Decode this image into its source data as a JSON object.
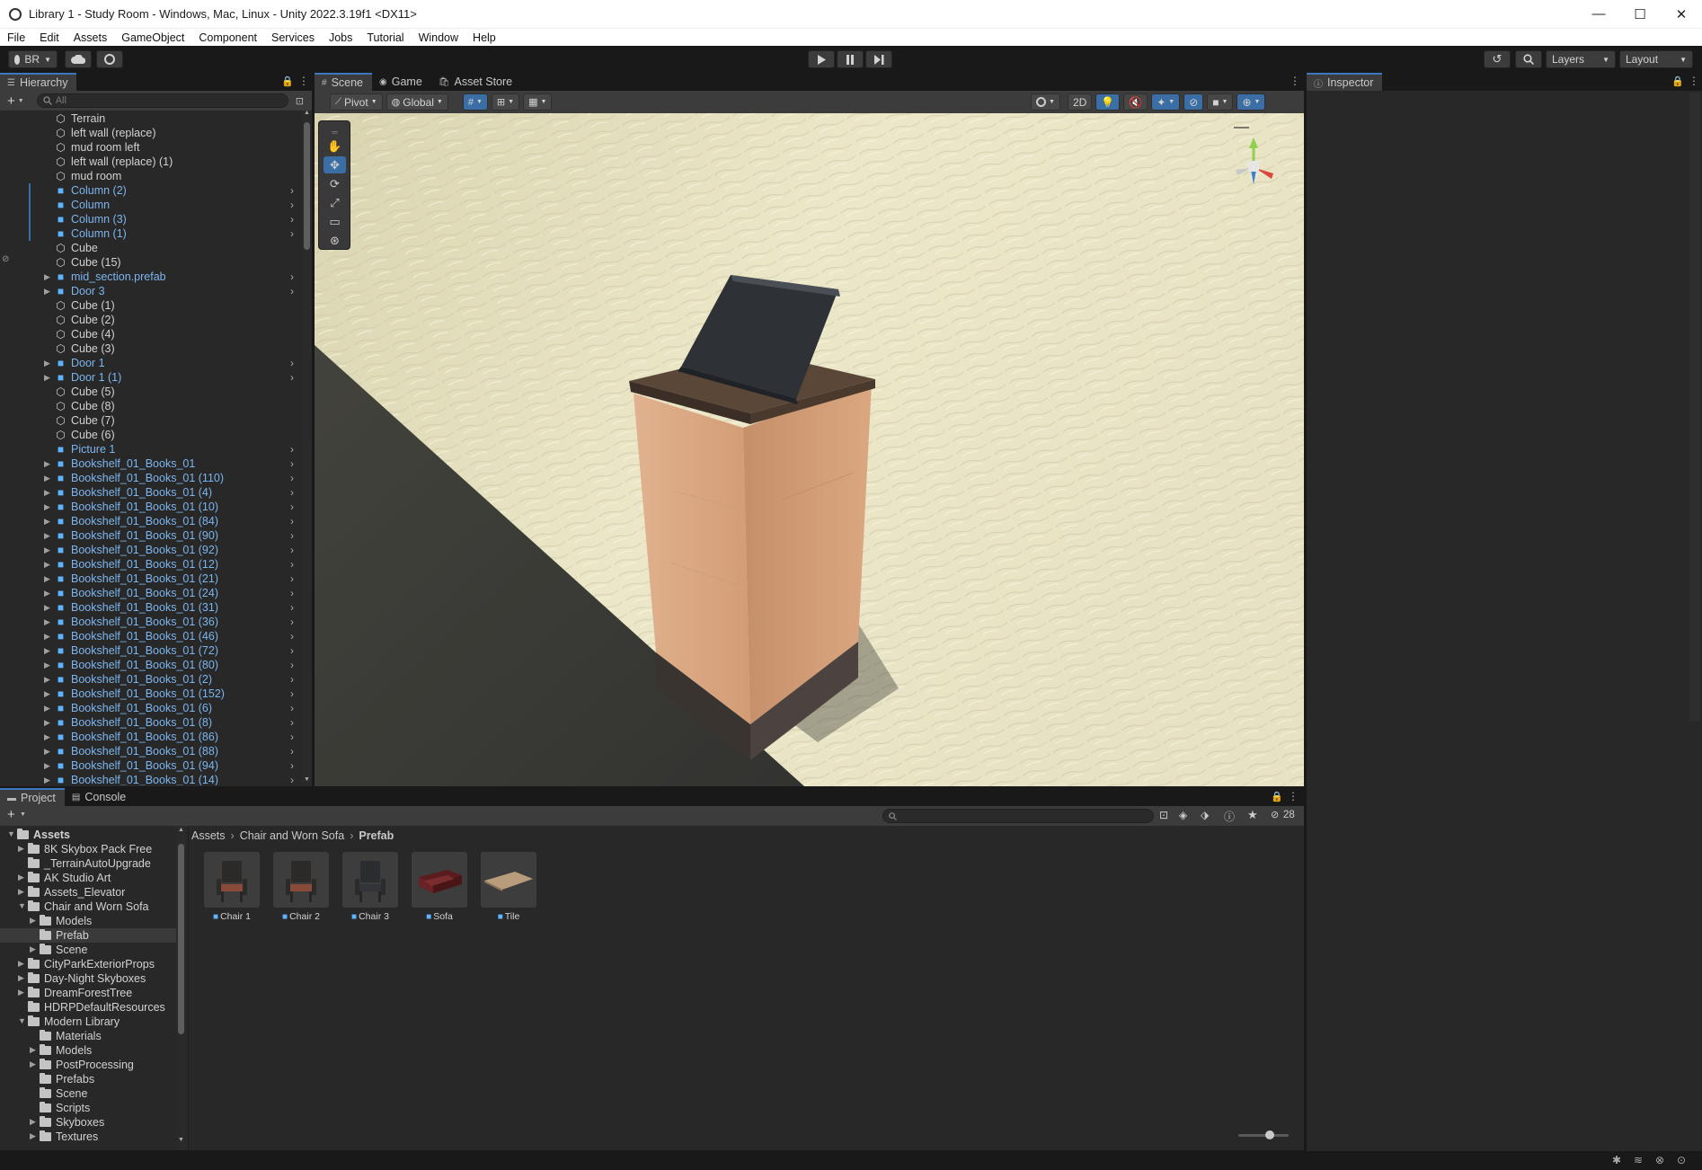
{
  "window": {
    "title": "Library 1 - Study Room - Windows, Mac, Linux - Unity 2022.3.19f1 <DX11>",
    "minimize": "—",
    "maximize": "☐",
    "close": "✕"
  },
  "menu": [
    "File",
    "Edit",
    "Assets",
    "GameObject",
    "Component",
    "Services",
    "Jobs",
    "Tutorial",
    "Window",
    "Help"
  ],
  "toolbar": {
    "account": "BR",
    "layers": "Layers",
    "layout": "Layout"
  },
  "hierarchy": {
    "tab": "Hierarchy",
    "search_placeholder": "All",
    "items": [
      {
        "name": "Terrain",
        "prefab": false,
        "expandable": false
      },
      {
        "name": "left wall (replace)",
        "prefab": false,
        "expandable": false
      },
      {
        "name": "mud room left",
        "prefab": false,
        "expandable": false
      },
      {
        "name": "left wall (replace) (1)",
        "prefab": false,
        "expandable": false
      },
      {
        "name": "mud room",
        "prefab": false,
        "expandable": false
      },
      {
        "name": "Column (2)",
        "prefab": true,
        "expandable": false
      },
      {
        "name": "Column",
        "prefab": true,
        "expandable": false
      },
      {
        "name": "Column (3)",
        "prefab": true,
        "expandable": false
      },
      {
        "name": "Column (1)",
        "prefab": true,
        "expandable": false
      },
      {
        "name": "Cube",
        "prefab": false,
        "expandable": false
      },
      {
        "name": "Cube (15)",
        "prefab": false,
        "expandable": false
      },
      {
        "name": "mid_section.prefab",
        "prefab": true,
        "expandable": true
      },
      {
        "name": "Door 3",
        "prefab": true,
        "expandable": true
      },
      {
        "name": "Cube (1)",
        "prefab": false,
        "expandable": false
      },
      {
        "name": "Cube (2)",
        "prefab": false,
        "expandable": false
      },
      {
        "name": "Cube (4)",
        "prefab": false,
        "expandable": false
      },
      {
        "name": "Cube (3)",
        "prefab": false,
        "expandable": false
      },
      {
        "name": "Door 1",
        "prefab": true,
        "expandable": true
      },
      {
        "name": "Door 1 (1)",
        "prefab": true,
        "expandable": true
      },
      {
        "name": "Cube (5)",
        "prefab": false,
        "expandable": false
      },
      {
        "name": "Cube (8)",
        "prefab": false,
        "expandable": false
      },
      {
        "name": "Cube (7)",
        "prefab": false,
        "expandable": false
      },
      {
        "name": "Cube (6)",
        "prefab": false,
        "expandable": false
      },
      {
        "name": "Picture 1",
        "prefab": true,
        "expandable": false
      },
      {
        "name": "Bookshelf_01_Books_01",
        "prefab": true,
        "expandable": true
      },
      {
        "name": "Bookshelf_01_Books_01 (110)",
        "prefab": true,
        "expandable": true
      },
      {
        "name": "Bookshelf_01_Books_01 (4)",
        "prefab": true,
        "expandable": true
      },
      {
        "name": "Bookshelf_01_Books_01 (10)",
        "prefab": true,
        "expandable": true
      },
      {
        "name": "Bookshelf_01_Books_01 (84)",
        "prefab": true,
        "expandable": true
      },
      {
        "name": "Bookshelf_01_Books_01 (90)",
        "prefab": true,
        "expandable": true
      },
      {
        "name": "Bookshelf_01_Books_01 (92)",
        "prefab": true,
        "expandable": true
      },
      {
        "name": "Bookshelf_01_Books_01 (12)",
        "prefab": true,
        "expandable": true
      },
      {
        "name": "Bookshelf_01_Books_01 (21)",
        "prefab": true,
        "expandable": true
      },
      {
        "name": "Bookshelf_01_Books_01 (24)",
        "prefab": true,
        "expandable": true
      },
      {
        "name": "Bookshelf_01_Books_01 (31)",
        "prefab": true,
        "expandable": true
      },
      {
        "name": "Bookshelf_01_Books_01 (36)",
        "prefab": true,
        "expandable": true
      },
      {
        "name": "Bookshelf_01_Books_01 (46)",
        "prefab": true,
        "expandable": true
      },
      {
        "name": "Bookshelf_01_Books_01 (72)",
        "prefab": true,
        "expandable": true
      },
      {
        "name": "Bookshelf_01_Books_01 (80)",
        "prefab": true,
        "expandable": true
      },
      {
        "name": "Bookshelf_01_Books_01 (2)",
        "prefab": true,
        "expandable": true
      },
      {
        "name": "Bookshelf_01_Books_01 (152)",
        "prefab": true,
        "expandable": true
      },
      {
        "name": "Bookshelf_01_Books_01 (6)",
        "prefab": true,
        "expandable": true
      },
      {
        "name": "Bookshelf_01_Books_01 (8)",
        "prefab": true,
        "expandable": true
      },
      {
        "name": "Bookshelf_01_Books_01 (86)",
        "prefab": true,
        "expandable": true
      },
      {
        "name": "Bookshelf_01_Books_01 (88)",
        "prefab": true,
        "expandable": true
      },
      {
        "name": "Bookshelf_01_Books_01 (94)",
        "prefab": true,
        "expandable": true
      },
      {
        "name": "Bookshelf_01_Books_01 (14)",
        "prefab": true,
        "expandable": true
      }
    ]
  },
  "scene_tabs": [
    "Scene",
    "Game",
    "Asset Store"
  ],
  "scene_toolbar": {
    "pivot": "Pivot",
    "global": "Global",
    "mode_2d": "2D"
  },
  "inspector": {
    "tab": "Inspector"
  },
  "project": {
    "tabs": [
      "Project",
      "Console"
    ],
    "visible_count": "28",
    "breadcrumb": [
      "Assets",
      "Chair and Worn Sofa",
      "Prefab"
    ],
    "tree": [
      {
        "name": "Assets",
        "depth": 0,
        "open": true,
        "bold": true
      },
      {
        "name": "8K Skybox Pack Free",
        "depth": 1,
        "open": false,
        "arrow": true
      },
      {
        "name": "_TerrainAutoUpgrade",
        "depth": 1,
        "open": false,
        "arrow": false
      },
      {
        "name": "AK Studio Art",
        "depth": 1,
        "open": false,
        "arrow": true
      },
      {
        "name": "Assets_Elevator",
        "depth": 1,
        "open": false,
        "arrow": true
      },
      {
        "name": "Chair and Worn Sofa",
        "depth": 1,
        "open": true,
        "arrow": true
      },
      {
        "name": "Models",
        "depth": 2,
        "open": false,
        "arrow": true
      },
      {
        "name": "Prefab",
        "depth": 2,
        "open": false,
        "arrow": false,
        "selected": true
      },
      {
        "name": "Scene",
        "depth": 2,
        "open": false,
        "arrow": true
      },
      {
        "name": "CityParkExteriorProps",
        "depth": 1,
        "open": false,
        "arrow": true
      },
      {
        "name": "Day-Night Skyboxes",
        "depth": 1,
        "open": false,
        "arrow": true
      },
      {
        "name": "DreamForestTree",
        "depth": 1,
        "open": false,
        "arrow": true
      },
      {
        "name": "HDRPDefaultResources",
        "depth": 1,
        "open": false,
        "arrow": false
      },
      {
        "name": "Modern Library",
        "depth": 1,
        "open": true,
        "arrow": true
      },
      {
        "name": "Materials",
        "depth": 2,
        "open": false,
        "arrow": false
      },
      {
        "name": "Models",
        "depth": 2,
        "open": false,
        "arrow": true
      },
      {
        "name": "PostProcessing",
        "depth": 2,
        "open": false,
        "arrow": true
      },
      {
        "name": "Prefabs",
        "depth": 2,
        "open": false,
        "arrow": false
      },
      {
        "name": "Scene",
        "depth": 2,
        "open": false,
        "arrow": false
      },
      {
        "name": "Scripts",
        "depth": 2,
        "open": false,
        "arrow": false
      },
      {
        "name": "Skyboxes",
        "depth": 2,
        "open": false,
        "arrow": true
      },
      {
        "name": "Textures",
        "depth": 2,
        "open": false,
        "arrow": true
      }
    ],
    "assets": [
      {
        "label": "Chair 1",
        "kind": "chair",
        "variant": "brown"
      },
      {
        "label": "Chair 2",
        "kind": "chair",
        "variant": "brown"
      },
      {
        "label": "Chair 3",
        "kind": "chair",
        "variant": "dark"
      },
      {
        "label": "Sofa",
        "kind": "sofa",
        "variant": "red"
      },
      {
        "label": "Tile",
        "kind": "tile",
        "variant": "tan"
      }
    ]
  },
  "colors": {
    "accent": "#3a6ea5",
    "prefab_text": "#7cb5ee",
    "prefab_icon": "#5fb4ff",
    "wall": "#e8e3c2",
    "floor": "#3e3e3b",
    "podium_wood": "#dba781",
    "podium_top": "#4a3a2e"
  }
}
